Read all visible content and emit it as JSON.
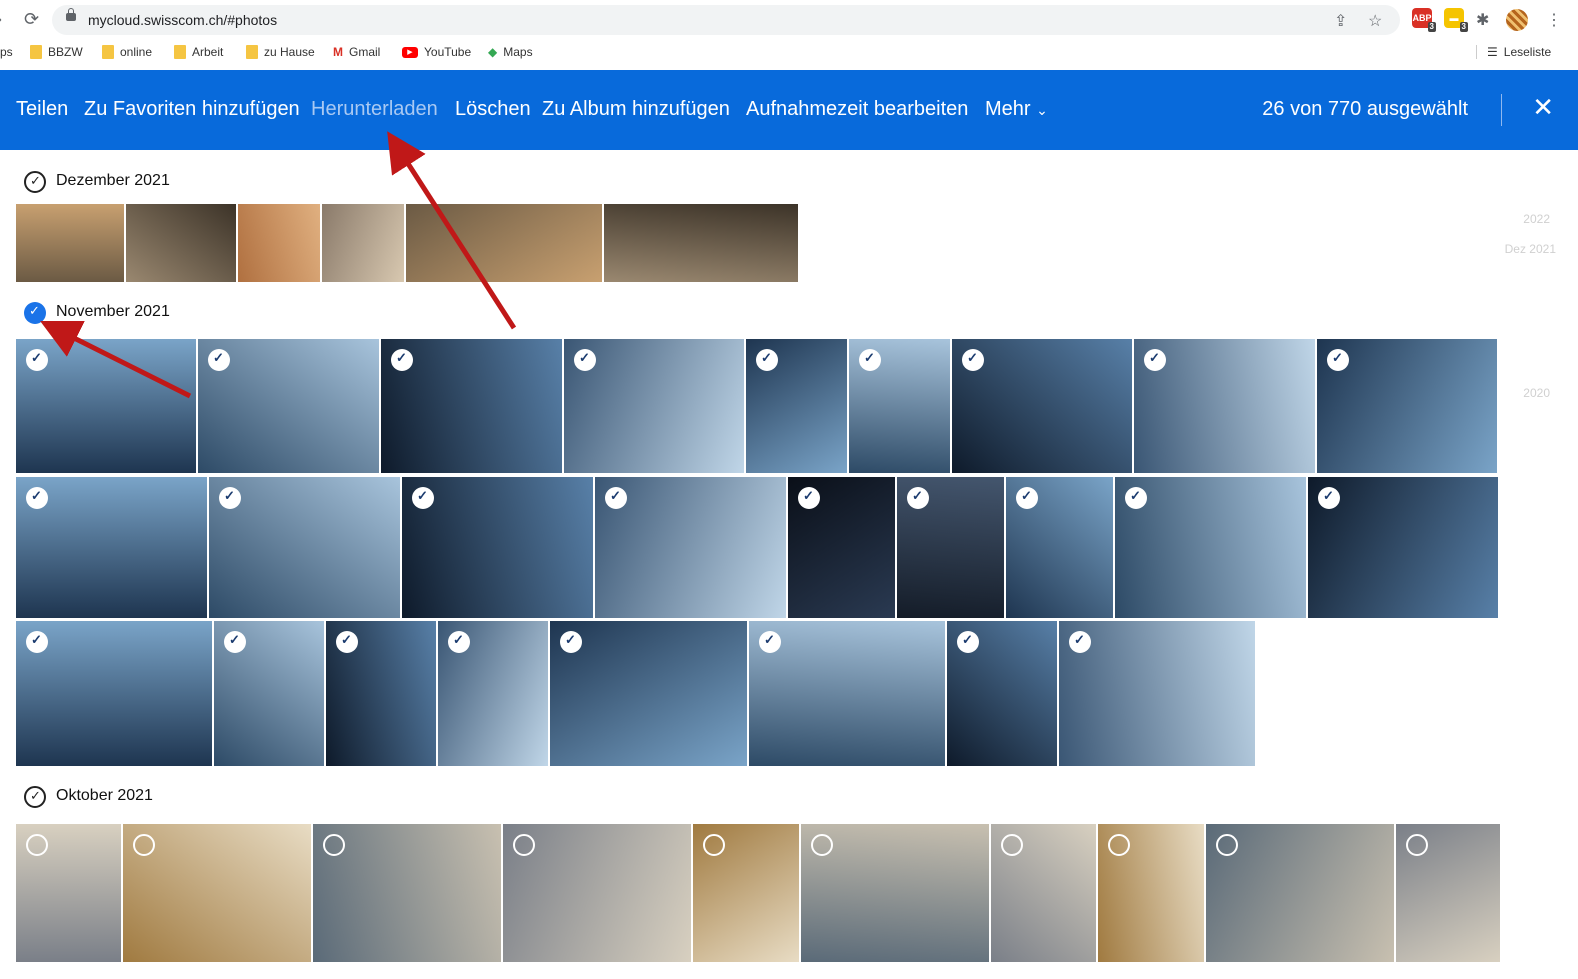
{
  "browser": {
    "url": "mycloud.swisscom.ch/#photos",
    "bookmarks": [
      "ps",
      "BBZW",
      "online",
      "Arbeit",
      "zu Hause",
      "Gmail",
      "YouTube",
      "Maps"
    ],
    "reading_list": "Leseliste",
    "extension_badges": [
      "3",
      "3"
    ]
  },
  "toolbar": {
    "actions": [
      "Teilen",
      "Zu Favoriten hinzufügen",
      "Herunterladen",
      "Löschen",
      "Zu Album hinzufügen",
      "Aufnahmezeit bearbeiten",
      "Mehr"
    ],
    "selection": "26 von 770 ausgewählt",
    "accent": "#086adb"
  },
  "sections": [
    {
      "title": "Dezember 2021",
      "state": "outline"
    },
    {
      "title": "November 2021",
      "state": "selected"
    },
    {
      "title": "Oktober 2021",
      "state": "outline"
    }
  ],
  "timeline": [
    "2022",
    "Dez 2021",
    "2020"
  ]
}
